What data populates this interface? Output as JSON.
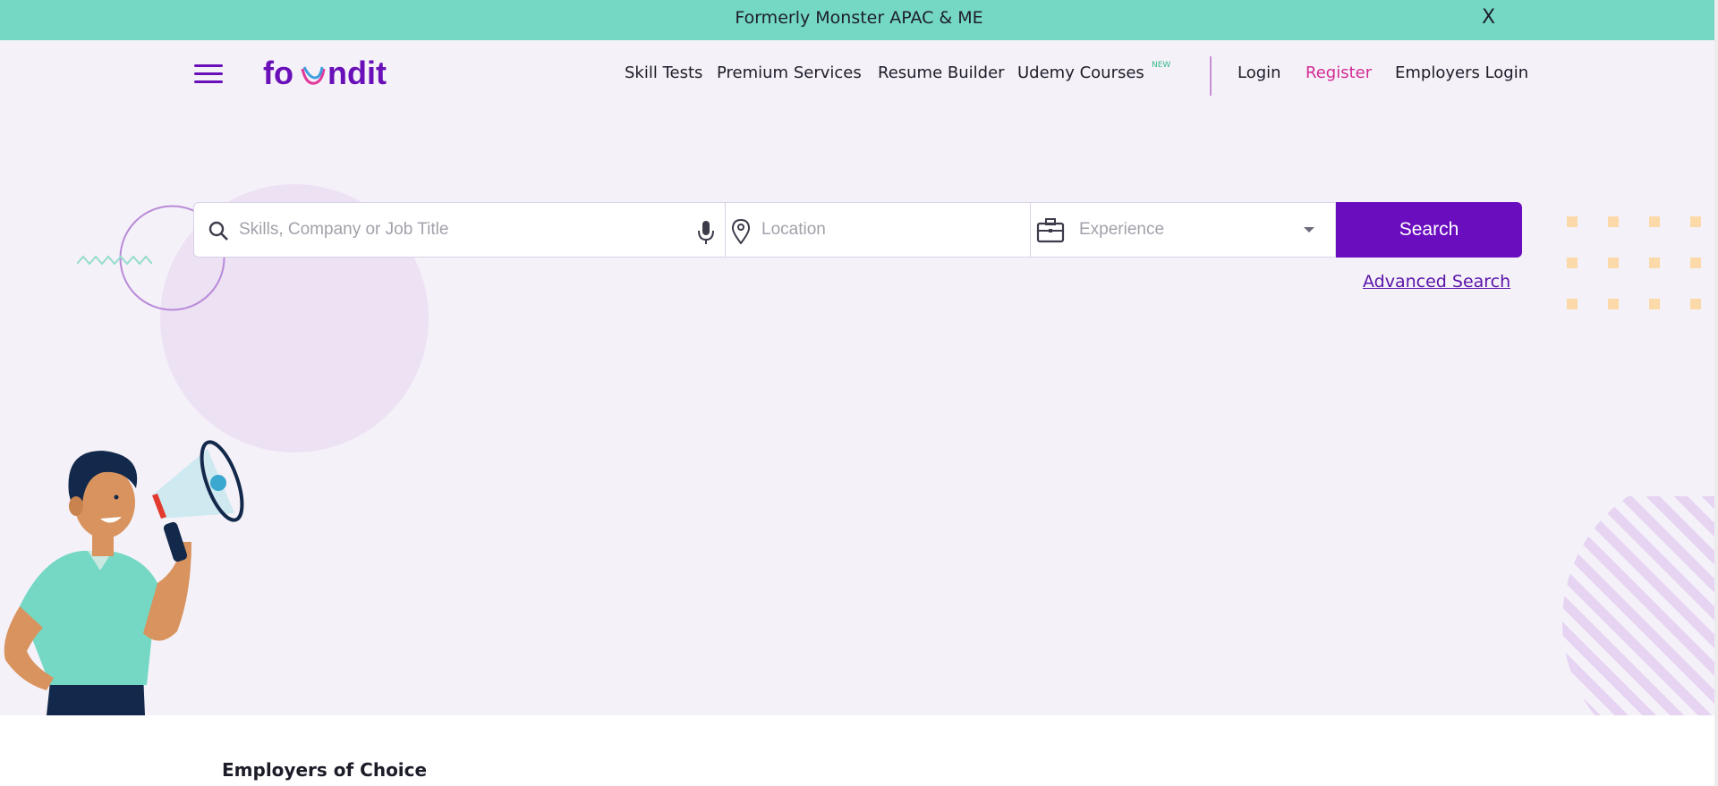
{
  "banner": {
    "text": "Formerly Monster APAC & ME",
    "close_label": "X"
  },
  "header": {
    "logo_text": "foundit",
    "nav": [
      {
        "label": "Skill Tests"
      },
      {
        "label": "Premium Services"
      },
      {
        "label": "Resume Builder"
      },
      {
        "label": "Udemy Courses",
        "badge": "NEW"
      }
    ],
    "auth": {
      "login": "Login",
      "register": "Register",
      "employers_login": "Employers Login"
    }
  },
  "search": {
    "skills_placeholder": "Skills, Company or Job Title",
    "location_placeholder": "Location",
    "experience_placeholder": "Experience",
    "button_label": "Search",
    "advanced_label": "Advanced Search"
  },
  "section": {
    "title": "Employers of Choice"
  },
  "colors": {
    "banner_bg": "#74d8c4",
    "brand_purple": "#6a0dbf",
    "register_pink": "#d22a93",
    "page_bg": "#f5f1f9"
  }
}
